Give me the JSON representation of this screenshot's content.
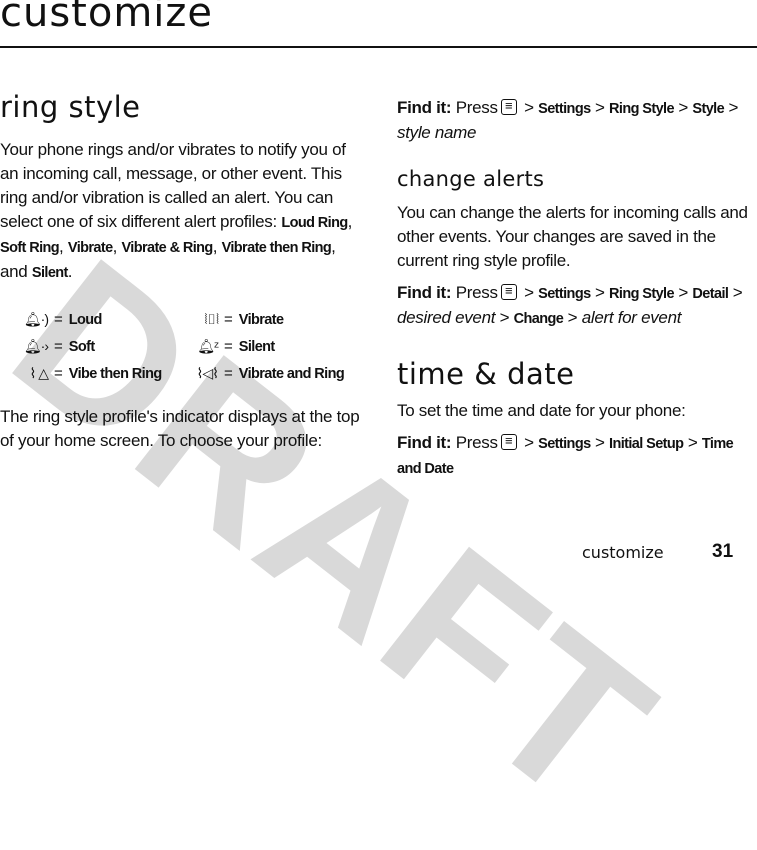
{
  "watermark": "DRAFT",
  "page": {
    "title": "customize",
    "footer_section": "customize",
    "footer_page_number": "31"
  },
  "ring_style": {
    "heading": "ring style",
    "intro_text": "Your phone rings and/or vibrates to notify you of an incoming call, message, or other event. This ring and/or vibration is called an alert. You can select one of six different alert profiles:",
    "profiles": [
      "Loud Ring",
      "Soft Ring",
      "Vibrate",
      "Vibrate & Ring",
      "Vibrate then Ring",
      "Silent"
    ],
    "profiles_sep": ", ",
    "profiles_and": ", and ",
    "profiles_end": ".",
    "legend": [
      {
        "icon": "loud-ring-icon",
        "glyph": "🔔︎·)",
        "label": "Loud"
      },
      {
        "icon": "vibrate-icon",
        "glyph": "⦚▯⦚",
        "label": "Vibrate"
      },
      {
        "icon": "soft-ring-icon",
        "glyph": "🔔︎·›",
        "label": "Soft"
      },
      {
        "icon": "silent-icon",
        "glyph": "🔔︎ᶻ",
        "label": "Silent"
      },
      {
        "icon": "vibe-then-ring-icon",
        "glyph": "⌇ △",
        "label": "Vibe then Ring"
      },
      {
        "icon": "vibrate-and-ring-icon",
        "glyph": "⌇◁⌇",
        "label": "Vibrate and Ring"
      }
    ],
    "legend_equals": "=",
    "indicator_text": "The ring style profile's indicator displays at the top of your home screen. To choose your profile:",
    "find_it": {
      "label": "Find it:",
      "press": "Press",
      "path": [
        {
          "text": "Settings",
          "style": "bold"
        },
        {
          "text": "Ring Style",
          "style": "bold"
        },
        {
          "text": "Style",
          "style": "bold"
        },
        {
          "text": "style name",
          "style": "italic"
        }
      ]
    }
  },
  "change_alerts": {
    "heading": "change alerts",
    "text": "You can change the alerts for incoming calls and other events. Your changes are saved in the current ring style profile.",
    "find_it": {
      "label": "Find it:",
      "press": "Press",
      "path": [
        {
          "text": "Settings",
          "style": "bold"
        },
        {
          "text": "Ring Style",
          "style": "bold"
        },
        {
          "text": "Detail",
          "style": "bold"
        },
        {
          "text": "desired event",
          "style": "italic"
        },
        {
          "text": "Change",
          "style": "bold"
        },
        {
          "text": "alert for event",
          "style": "italic"
        }
      ]
    }
  },
  "time_date": {
    "heading": "time & date",
    "text": "To set the time and date for your phone:",
    "find_it": {
      "label": "Find it:",
      "press": "Press",
      "path": [
        {
          "text": "Settings",
          "style": "bold"
        },
        {
          "text": "Initial Setup",
          "style": "bold"
        },
        {
          "text": "Time and Date",
          "style": "bold"
        }
      ]
    }
  },
  "menu_key_icon": "menu-key-icon",
  "path_separator": ">"
}
